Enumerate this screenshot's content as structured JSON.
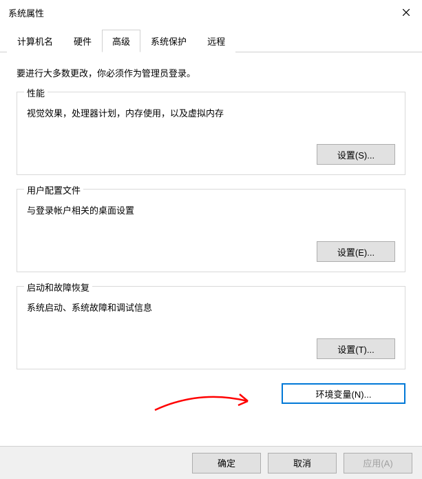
{
  "titlebar": {
    "title": "系统属性"
  },
  "tabs": {
    "computer_name": "计算机名",
    "hardware": "硬件",
    "advanced": "高级",
    "system_protection": "系统保护",
    "remote": "远程"
  },
  "content": {
    "intro": "要进行大多数更改，你必须作为管理员登录。",
    "performance": {
      "legend": "性能",
      "desc": "视觉效果，处理器计划，内存使用，以及虚拟内存",
      "button": "设置(S)..."
    },
    "user_profiles": {
      "legend": "用户配置文件",
      "desc": "与登录帐户相关的桌面设置",
      "button": "设置(E)..."
    },
    "startup": {
      "legend": "启动和故障恢复",
      "desc": "系统启动、系统故障和调试信息",
      "button": "设置(T)..."
    },
    "env_var_button": "环境变量(N)..."
  },
  "bottom": {
    "ok": "确定",
    "cancel": "取消",
    "apply": "应用(A)"
  }
}
